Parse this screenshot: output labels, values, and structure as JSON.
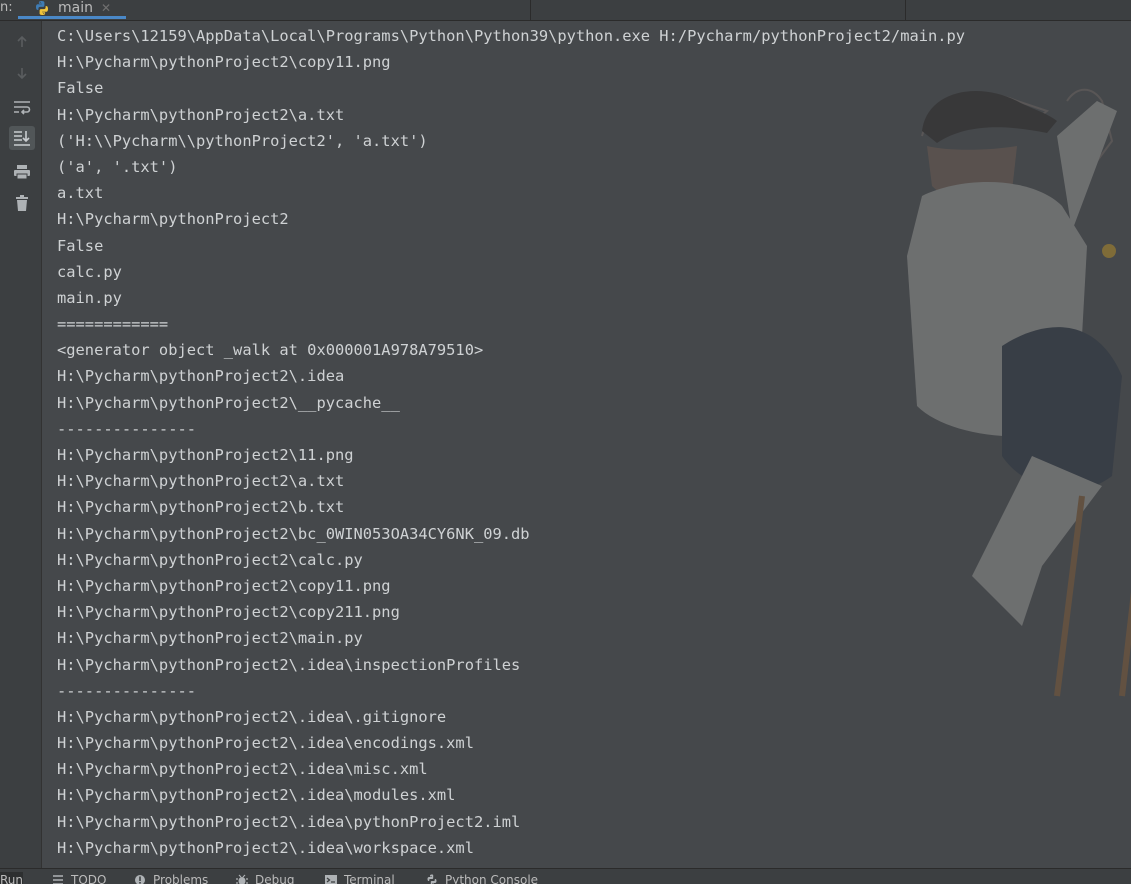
{
  "run_tab": {
    "prefix": "n:",
    "label": "main",
    "close_glyph": "✕"
  },
  "toolbar": {
    "buttons": [
      {
        "name": "up-arrow-icon",
        "enabled": false
      },
      {
        "name": "down-arrow-icon",
        "enabled": false
      },
      {
        "name": "soft-wrap-icon",
        "enabled": true
      },
      {
        "name": "scroll-to-end-icon",
        "enabled": true,
        "active": true
      },
      {
        "name": "print-icon",
        "enabled": true
      },
      {
        "name": "trash-icon",
        "enabled": true
      }
    ]
  },
  "console": {
    "lines": [
      "C:\\Users\\12159\\AppData\\Local\\Programs\\Python\\Python39\\python.exe H:/Pycharm/pythonProject2/main.py",
      "H:\\Pycharm\\pythonProject2\\copy11.png",
      "False",
      "H:\\Pycharm\\pythonProject2\\a.txt",
      "('H:\\\\Pycharm\\\\pythonProject2', 'a.txt')",
      "('a', '.txt')",
      "a.txt",
      "H:\\Pycharm\\pythonProject2",
      "False",
      "calc.py",
      "main.py",
      "============",
      "<generator object _walk at 0x000001A978A79510>",
      "H:\\Pycharm\\pythonProject2\\.idea",
      "H:\\Pycharm\\pythonProject2\\__pycache__",
      "---------------",
      "H:\\Pycharm\\pythonProject2\\11.png",
      "H:\\Pycharm\\pythonProject2\\a.txt",
      "H:\\Pycharm\\pythonProject2\\b.txt",
      "H:\\Pycharm\\pythonProject2\\bc_0WIN053OA34CY6NK_09.db",
      "H:\\Pycharm\\pythonProject2\\calc.py",
      "H:\\Pycharm\\pythonProject2\\copy11.png",
      "H:\\Pycharm\\pythonProject2\\copy211.png",
      "H:\\Pycharm\\pythonProject2\\main.py",
      "H:\\Pycharm\\pythonProject2\\.idea\\inspectionProfiles",
      "---------------",
      "H:\\Pycharm\\pythonProject2\\.idea\\.gitignore",
      "H:\\Pycharm\\pythonProject2\\.idea\\encodings.xml",
      "H:\\Pycharm\\pythonProject2\\.idea\\misc.xml",
      "H:\\Pycharm\\pythonProject2\\.idea\\modules.xml",
      "H:\\Pycharm\\pythonProject2\\.idea\\pythonProject2.iml",
      "H:\\Pycharm\\pythonProject2\\.idea\\workspace.xml"
    ]
  },
  "bottom_tabs": [
    {
      "label": "Run",
      "icon": "run-icon",
      "active": true
    },
    {
      "label": "TODO",
      "icon": "todo-icon"
    },
    {
      "label": "Problems",
      "icon": "problems-icon"
    },
    {
      "label": "Debug",
      "icon": "debug-icon"
    },
    {
      "label": "Terminal",
      "icon": "terminal-icon"
    },
    {
      "label": "Python Console",
      "icon": "python-console-icon"
    }
  ],
  "colors": {
    "console_bg": "#45484b",
    "console_text": "#cfd2d4",
    "panel_bg": "#3c3f41",
    "tab_underline": "#4a88c7"
  }
}
